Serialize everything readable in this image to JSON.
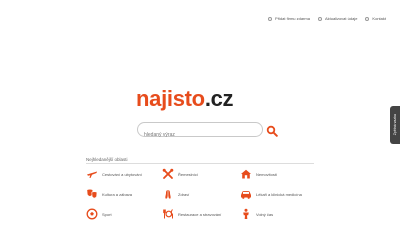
{
  "topnav": [
    {
      "label": "Přidat firmu zdarma",
      "icon": "circle-icon"
    },
    {
      "label": "Aktualizovat údaje",
      "icon": "circle-icon"
    },
    {
      "label": "Kontakt",
      "icon": "circle-icon"
    }
  ],
  "logo": {
    "name": "najisto",
    "dot": ".",
    "tld": "cz"
  },
  "search": {
    "placeholder": "hledaný výraz"
  },
  "side_tab": {
    "label": "Zpětná vazba"
  },
  "section": {
    "title": "Nejhledanější oblasti"
  },
  "categories": [
    {
      "label": "Cestování a ubytování",
      "icon": "airplane-icon"
    },
    {
      "label": "Řemeslníci",
      "icon": "tools-icon"
    },
    {
      "label": "Nemovitosti",
      "icon": "house-icon"
    },
    {
      "label": "Kultura a zábava",
      "icon": "masks-icon"
    },
    {
      "label": "Zdraví",
      "icon": "health-icon"
    },
    {
      "label": "Lékaři a klinická medicína",
      "icon": "car-icon"
    },
    {
      "label": "Sport",
      "icon": "ball-icon"
    },
    {
      "label": "Restaurace a stravování",
      "icon": "food-icon"
    },
    {
      "label": "Volný čas",
      "icon": "person-icon"
    }
  ],
  "colors": {
    "accent": "#e74c1c",
    "text": "#444444"
  }
}
